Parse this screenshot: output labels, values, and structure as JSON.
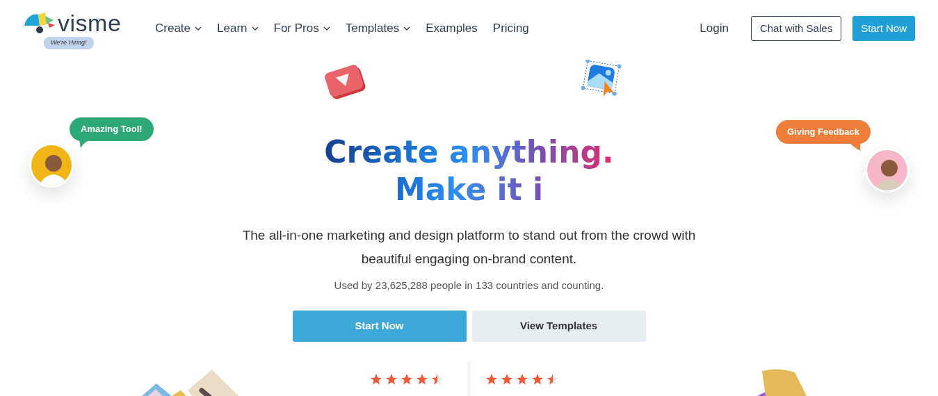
{
  "header": {
    "logo": {
      "wordmark": "visme",
      "badge": "We're Hiring!"
    },
    "nav": [
      {
        "label": "Create",
        "dropdown": true
      },
      {
        "label": "Learn",
        "dropdown": true
      },
      {
        "label": "For Pros",
        "dropdown": true
      },
      {
        "label": "Templates",
        "dropdown": true
      },
      {
        "label": "Examples",
        "dropdown": false
      },
      {
        "label": "Pricing",
        "dropdown": false
      }
    ],
    "login": "Login",
    "buttons": [
      {
        "label": "Chat with Sales",
        "kind": "outline"
      },
      {
        "label": "Start Now",
        "kind": "solid"
      }
    ]
  },
  "hero": {
    "bubbles": [
      {
        "text": "Amazing Tool!",
        "color": "#2ea876"
      },
      {
        "text": "Giving Feedback",
        "color": "#ee7d3b"
      }
    ],
    "headline": [
      "Create anything.",
      "Make it i"
    ],
    "subtitle": "The all-in-one marketing and design platform to stand out from the crowd with beautiful engaging on-brand content.",
    "stats": "Used by 23,625,288 people in 133 countries and counting.",
    "buttons": [
      {
        "label": "Start Now",
        "kind": "primary"
      },
      {
        "label": "View Templates",
        "kind": "secondary"
      }
    ]
  },
  "ratings": [
    {
      "stars": 4.5
    },
    {
      "stars": 4.5
    }
  ]
}
